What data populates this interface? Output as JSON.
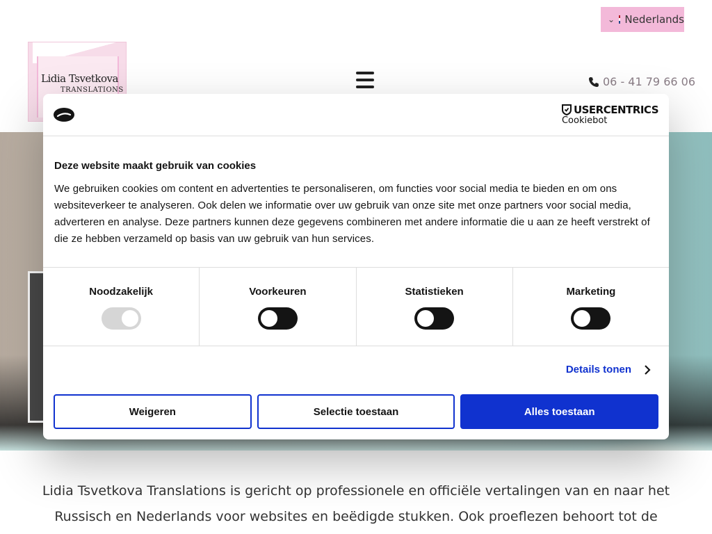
{
  "language": {
    "label": "Nederlands",
    "flag_colors": [
      "#ae1c28",
      "#ffffff",
      "#21468b"
    ]
  },
  "header": {
    "logo_line1": "Lidia Tsvetkova",
    "logo_line2": "Translations",
    "phone": "06 - 41 79 66 06"
  },
  "intro_text": "Lidia Tsvetkova Translations is gericht op professionele en officiële vertalingen van en naar het Russisch en Nederlands voor websites en beëdigde stukken. Ook proeflezen behoort tot de",
  "cookie_dialog": {
    "provider_brand": "USERCENTRICS",
    "provider_product": "Cookiebot",
    "title": "Deze website maakt gebruik van cookies",
    "text": "We gebruiken cookies om content en advertenties te personaliseren, om functies voor social media te bieden en om ons websiteverkeer te analyseren. Ook delen we informatie over uw gebruik van onze site met onze partners voor social media, adverteren en analyse. Deze partners kunnen deze gegevens combineren met andere informatie die u aan ze heeft verstrekt of die ze hebben verzameld op basis van uw gebruik van hun services.",
    "categories": [
      {
        "label": "Noodzakelijk",
        "enabled": true,
        "locked": true
      },
      {
        "label": "Voorkeuren",
        "enabled": false,
        "locked": false
      },
      {
        "label": "Statistieken",
        "enabled": false,
        "locked": false
      },
      {
        "label": "Marketing",
        "enabled": false,
        "locked": false
      }
    ],
    "details_label": "Details tonen",
    "buttons": {
      "deny": "Weigeren",
      "allow_selection": "Selectie toestaan",
      "allow_all": "Alles toestaan"
    },
    "accent_color": "#1032cf"
  }
}
